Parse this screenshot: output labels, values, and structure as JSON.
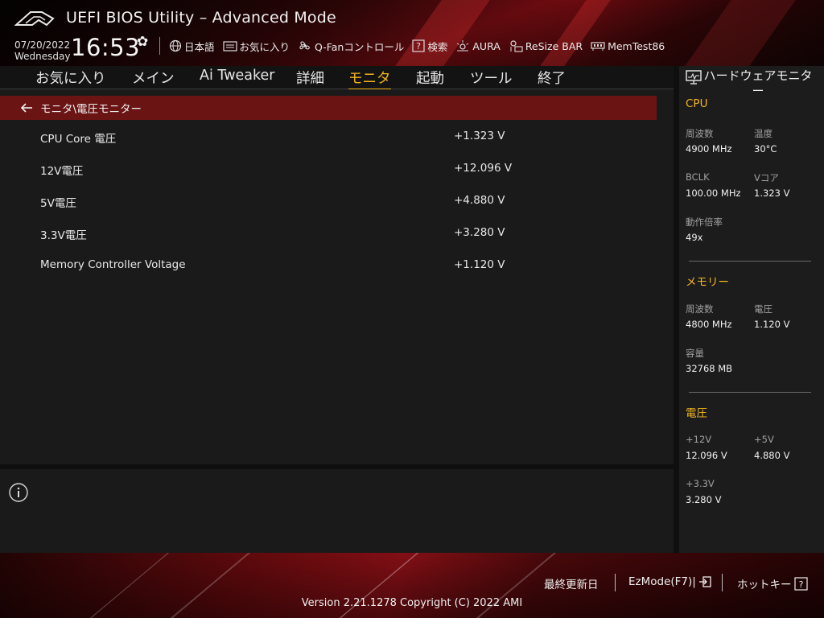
{
  "header": {
    "title": "UEFI BIOS Utility – Advanced Mode",
    "date": "07/20/2022",
    "weekday": "Wednesday",
    "time": "16:53",
    "toolbar": [
      {
        "icon": "globe-icon",
        "label": "日本語"
      },
      {
        "icon": "bookmark-icon",
        "label": "お気に入り"
      },
      {
        "icon": "fan-icon",
        "label": "Q-Fanコントロール"
      },
      {
        "icon": "help-icon",
        "label": "検索"
      },
      {
        "icon": "aura-icon",
        "label": "AURA"
      },
      {
        "icon": "resize-bar-icon",
        "label": "ReSize BAR"
      },
      {
        "icon": "memory-icon",
        "label": "MemTest86"
      }
    ]
  },
  "nav": {
    "tabs": [
      "お気に入り",
      "メイン",
      "Ai Tweaker",
      "詳細",
      "モニタ",
      "起動",
      "ツール",
      "終了"
    ],
    "active": "モニタ"
  },
  "main": {
    "breadcrumb": "モニタ\\電圧モニター",
    "rows": [
      {
        "label": "CPU Core 電圧",
        "value": "+1.323 V"
      },
      {
        "label": "12V電圧",
        "value": "+12.096 V"
      },
      {
        "label": "5V電圧",
        "value": "+4.880 V"
      },
      {
        "label": "3.3V電圧",
        "value": "+3.280 V"
      },
      {
        "label": "Memory Controller Voltage",
        "value": "+1.120 V"
      }
    ]
  },
  "hwmon": {
    "title": "ハードウェアモニター",
    "cpu": {
      "title": "CPU",
      "freq_label": "周波数",
      "freq_value": "4900 MHz",
      "temp_label": "温度",
      "temp_value": "30°C",
      "bclk_label": "BCLK",
      "bclk_value": "100.00 MHz",
      "vcore_label": "Vコア",
      "vcore_value": "1.323 V",
      "ratio_label": "動作倍率",
      "ratio_value": "49x"
    },
    "memory": {
      "title": "メモリー",
      "freq_label": "周波数",
      "freq_value": "4800 MHz",
      "volt_label": "電圧",
      "volt_value": "1.120 V",
      "cap_label": "容量",
      "cap_value": "32768 MB"
    },
    "voltage": {
      "title": "電圧",
      "v12_label": "+12V",
      "v12_value": "12.096 V",
      "v5_label": "+5V",
      "v5_value": "4.880 V",
      "v33_label": "+3.3V",
      "v33_value": "3.280 V"
    }
  },
  "footer": {
    "last_modified": "最終更新日",
    "ezmode": "EzMode(F7)|",
    "hotkeys": "ホットキー",
    "version": "Version 2.21.1278 Copyright (C) 2022 AMI"
  },
  "colors": {
    "accent": "#f2b41c",
    "breadcrumb_bg": "#6a1414",
    "brand_red": "#8e0f15"
  }
}
